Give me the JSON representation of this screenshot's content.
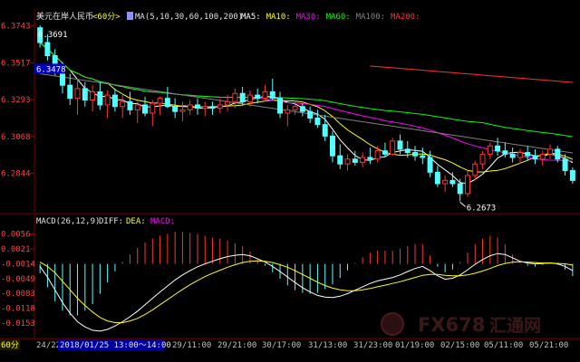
{
  "header": {
    "symbol": "美元在岸人民币",
    "period": "<60分>",
    "ma_label": "MA(5,10,30,60,100,200)",
    "ma_items": [
      {
        "label": "MA5:",
        "color": "#ffffff"
      },
      {
        "label": "MA10:",
        "color": "#ffff00"
      },
      {
        "label": "MA30:",
        "color": "#ff00ff"
      },
      {
        "label": "MA60:",
        "color": "#00ff00"
      },
      {
        "label": "MA100:",
        "color": "#808080"
      },
      {
        "label": "MA200:",
        "color": "#ff3030"
      }
    ]
  },
  "macd_header": {
    "label": "MACD(26,12,9)",
    "diff": "DIFF:",
    "dea": "DEA:",
    "macd": "MACD:"
  },
  "bottom_bar": {
    "period_tag": "60分",
    "highlight": "2018/01/25  13:00～14:00"
  },
  "watermark": {
    "text": "FX678",
    "cn": "汇通网"
  },
  "chart_data": [
    {
      "type": "candlestick",
      "y_ticks": [
        "6.3743",
        "6.3517",
        "6.3293",
        "6.3068",
        "6.2844"
      ],
      "ylim": [
        6.262,
        6.38
      ],
      "annotations": [
        {
          "text": "6.3691",
          "value": 6.3691,
          "kind": "high"
        },
        {
          "text": "6.3478",
          "value": 6.3478,
          "kind": "current"
        },
        {
          "text": "6.2673",
          "value": 6.2673,
          "kind": "low"
        }
      ],
      "x_labels": [
        "24/22",
        "29/11:00",
        "29/21:00",
        "30/17:00",
        "31/13:00",
        "31/23:00",
        "01/19:00",
        "02/15:00",
        "05/11:00",
        "05/21:00"
      ],
      "candles": [
        [
          6.373,
          6.3745,
          6.361,
          6.364
        ],
        [
          6.364,
          6.3691,
          6.353,
          6.356
        ],
        [
          6.356,
          6.36,
          6.344,
          6.3478
        ],
        [
          6.3478,
          6.352,
          6.333,
          6.338
        ],
        [
          6.338,
          6.345,
          6.326,
          6.33
        ],
        [
          6.33,
          6.342,
          6.32,
          6.336
        ],
        [
          6.336,
          6.34,
          6.325,
          6.329
        ],
        [
          6.329,
          6.338,
          6.322,
          6.334
        ],
        [
          6.334,
          6.34,
          6.323,
          6.326
        ],
        [
          6.326,
          6.335,
          6.318,
          6.332
        ],
        [
          6.332,
          6.336,
          6.322,
          6.325
        ],
        [
          6.325,
          6.332,
          6.318,
          6.328
        ],
        [
          6.328,
          6.334,
          6.32,
          6.323
        ],
        [
          6.323,
          6.328,
          6.315,
          6.326
        ],
        [
          6.326,
          6.331,
          6.319,
          6.321
        ],
        [
          6.321,
          6.329,
          6.313,
          6.327
        ],
        [
          6.327,
          6.331,
          6.32,
          6.33
        ],
        [
          6.33,
          6.337,
          6.324,
          6.325
        ],
        [
          6.325,
          6.33,
          6.318,
          6.322
        ],
        [
          6.322,
          6.328,
          6.316,
          6.323
        ],
        [
          6.323,
          6.329,
          6.32,
          6.326
        ],
        [
          6.326,
          6.33,
          6.32,
          6.324
        ],
        [
          6.324,
          6.328,
          6.319,
          6.325
        ],
        [
          6.325,
          6.328,
          6.32,
          6.324
        ],
        [
          6.324,
          6.33,
          6.321,
          6.326
        ],
        [
          6.326,
          6.332,
          6.322,
          6.328
        ],
        [
          6.328,
          6.336,
          6.324,
          6.333
        ],
        [
          6.333,
          6.337,
          6.326,
          6.328
        ],
        [
          6.328,
          6.335,
          6.325,
          6.332
        ],
        [
          6.332,
          6.336,
          6.327,
          6.33
        ],
        [
          6.33,
          6.338,
          6.328,
          6.334
        ],
        [
          6.334,
          6.342,
          6.329,
          6.33
        ],
        [
          6.33,
          6.334,
          6.318,
          6.321
        ],
        [
          6.321,
          6.326,
          6.313,
          6.323
        ],
        [
          6.323,
          6.329,
          6.32,
          6.325
        ],
        [
          6.325,
          6.327,
          6.319,
          6.322
        ],
        [
          6.322,
          6.325,
          6.315,
          6.318
        ],
        [
          6.318,
          6.323,
          6.312,
          6.314
        ],
        [
          6.314,
          6.32,
          6.304,
          6.307
        ],
        [
          6.307,
          6.31,
          6.291,
          6.295
        ],
        [
          6.295,
          6.302,
          6.287,
          6.29
        ],
        [
          6.29,
          6.296,
          6.286,
          6.293
        ],
        [
          6.293,
          6.298,
          6.289,
          6.291
        ],
        [
          6.291,
          6.297,
          6.288,
          6.294
        ],
        [
          6.294,
          6.3,
          6.29,
          6.293
        ],
        [
          6.293,
          6.301,
          6.291,
          6.298
        ],
        [
          6.298,
          6.303,
          6.294,
          6.296
        ],
        [
          6.296,
          6.306,
          6.295,
          6.304
        ],
        [
          6.304,
          6.308,
          6.296,
          6.299
        ],
        [
          6.299,
          6.304,
          6.294,
          6.297
        ],
        [
          6.297,
          6.301,
          6.292,
          6.295
        ],
        [
          6.295,
          6.3,
          6.29,
          6.294
        ],
        [
          6.294,
          6.298,
          6.282,
          6.285
        ],
        [
          6.285,
          6.289,
          6.276,
          6.278
        ],
        [
          6.278,
          6.283,
          6.273,
          6.28
        ],
        [
          6.28,
          6.285,
          6.276,
          6.278
        ],
        [
          6.278,
          6.281,
          6.2673,
          6.272
        ],
        [
          6.272,
          6.286,
          6.27,
          6.283
        ],
        [
          6.283,
          6.292,
          6.28,
          6.29
        ],
        [
          6.29,
          6.298,
          6.287,
          6.296
        ],
        [
          6.296,
          6.303,
          6.293,
          6.301
        ],
        [
          6.301,
          6.306,
          6.295,
          6.298
        ],
        [
          6.298,
          6.303,
          6.294,
          6.296
        ],
        [
          6.296,
          6.3,
          6.291,
          6.294
        ],
        [
          6.294,
          6.299,
          6.29,
          6.297
        ],
        [
          6.297,
          6.301,
          6.292,
          6.295
        ],
        [
          6.295,
          6.299,
          6.29,
          6.293
        ],
        [
          6.293,
          6.298,
          6.289,
          6.296
        ],
        [
          6.296,
          6.302,
          6.293,
          6.299
        ],
        [
          6.299,
          6.301,
          6.291,
          6.293
        ],
        [
          6.293,
          6.296,
          6.283,
          6.286
        ],
        [
          6.286,
          6.288,
          6.278,
          6.28
        ]
      ]
    },
    {
      "type": "macd",
      "y_ticks": [
        "0.0056",
        "0.0021",
        "-0.0014",
        "-0.0049",
        "-0.0083",
        "-0.0118",
        "-0.0153"
      ],
      "ylim": [
        -0.0185,
        0.007
      ],
      "series_labels": [
        "DIFF",
        "DEA",
        "MACD"
      ],
      "diff": [
        -0.002,
        -0.0045,
        -0.0075,
        -0.0105,
        -0.013,
        -0.015,
        -0.0162,
        -0.017,
        -0.0172,
        -0.0168,
        -0.016,
        -0.015,
        -0.0138,
        -0.0125,
        -0.011,
        -0.0095,
        -0.008,
        -0.0066,
        -0.0052,
        -0.004,
        -0.003,
        -0.0021,
        -0.0014,
        -0.0008,
        -0.0002,
        0.0003,
        0.0006,
        0.0008,
        0.0005,
        -0.0002,
        -0.001,
        -0.002,
        -0.0032,
        -0.0045,
        -0.0058,
        -0.007,
        -0.008,
        -0.0088,
        -0.0092,
        -0.0093,
        -0.009,
        -0.0084,
        -0.0076,
        -0.0068,
        -0.006,
        -0.0054,
        -0.005,
        -0.0046,
        -0.004,
        -0.0032,
        -0.0025,
        -0.002,
        -0.003,
        -0.0042,
        -0.005,
        -0.0048,
        -0.004,
        -0.0028,
        -0.0015,
        -0.0004,
        0.0005,
        0.001,
        0.0008,
        0.0,
        -0.0008,
        -0.0012,
        -0.0014,
        -0.0013,
        -0.0012,
        -0.0014,
        -0.002,
        -0.003
      ],
      "dea": [
        -0.001,
        -0.002,
        -0.0035,
        -0.0055,
        -0.0075,
        -0.0095,
        -0.0112,
        -0.0127,
        -0.014,
        -0.0148,
        -0.0152,
        -0.0152,
        -0.0148,
        -0.0142,
        -0.0133,
        -0.0122,
        -0.011,
        -0.0098,
        -0.0086,
        -0.0074,
        -0.0063,
        -0.0053,
        -0.0044,
        -0.0036,
        -0.0029,
        -0.0022,
        -0.0016,
        -0.0011,
        -0.0008,
        -0.0007,
        -0.0008,
        -0.0011,
        -0.0016,
        -0.0022,
        -0.003,
        -0.0039,
        -0.0048,
        -0.0057,
        -0.0065,
        -0.0071,
        -0.0075,
        -0.0077,
        -0.0077,
        -0.0075,
        -0.0072,
        -0.0068,
        -0.0064,
        -0.006,
        -0.0056,
        -0.0051,
        -0.0046,
        -0.0041,
        -0.0039,
        -0.0039,
        -0.0041,
        -0.0042,
        -0.0042,
        -0.004,
        -0.0036,
        -0.0031,
        -0.0025,
        -0.0018,
        -0.0013,
        -0.001,
        -0.0009,
        -0.001,
        -0.0011,
        -0.0012,
        -0.0012,
        -0.0013,
        -0.0014,
        -0.0017
      ]
    }
  ]
}
